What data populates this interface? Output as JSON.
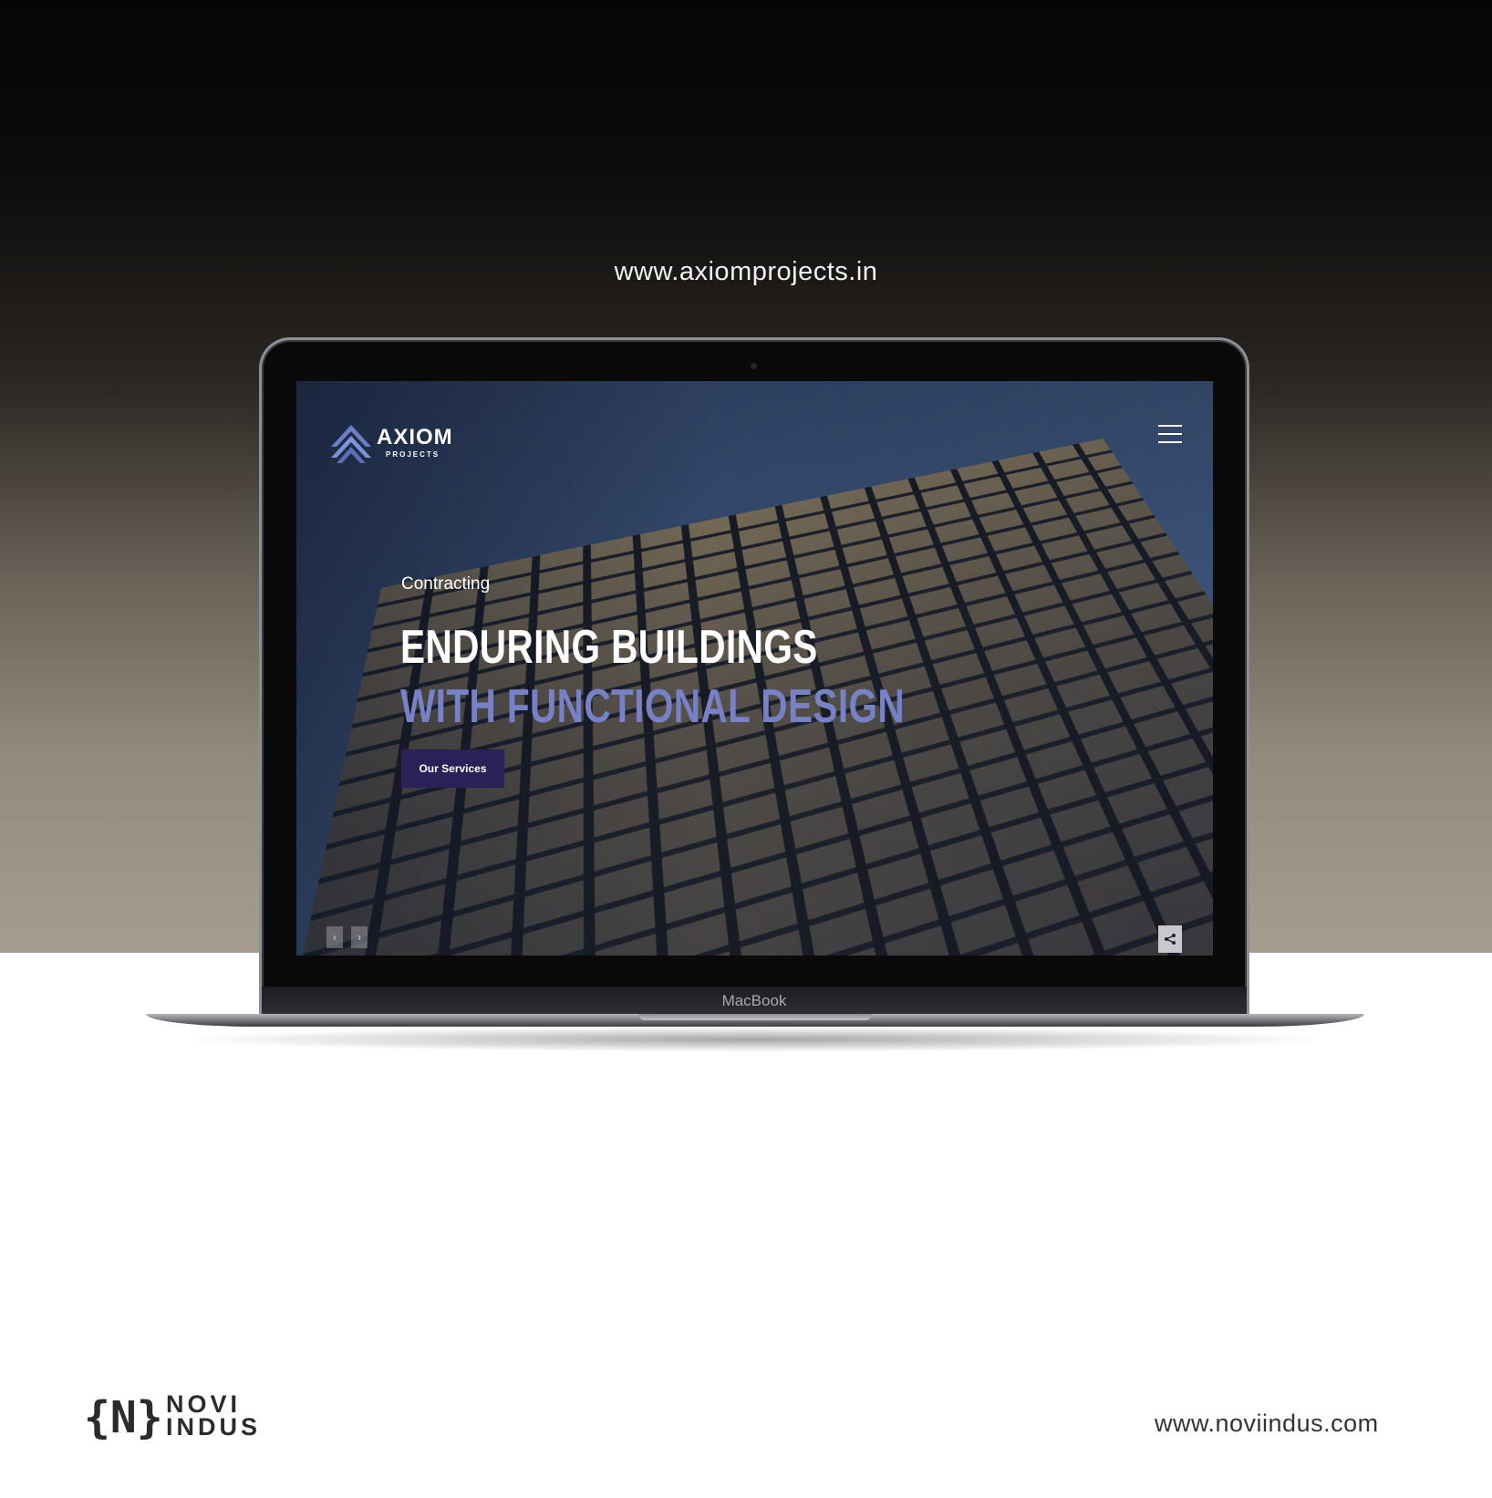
{
  "mockup": {
    "site_url": "www.axiomprojects.in",
    "laptop_brand": "MacBook"
  },
  "site": {
    "logo_word": "AXIOM",
    "logo_sub": "PROJECTS",
    "hero": {
      "kicker": "Contracting",
      "headline_line1": "ENDURING BUILDINGS",
      "headline_line2": "WITH FUNCTIONAL DESIGN",
      "cta_label": "Our Services"
    },
    "controls": {
      "prev_symbol": "‹",
      "next_symbol": "›"
    },
    "colors": {
      "accent": "#7781c6",
      "button_bg": "#2a2158"
    }
  },
  "footer": {
    "brand_line1": "NOVI",
    "brand_line2": "INDUS",
    "brand_mark": "{N}",
    "url": "www.noviindus.com"
  }
}
